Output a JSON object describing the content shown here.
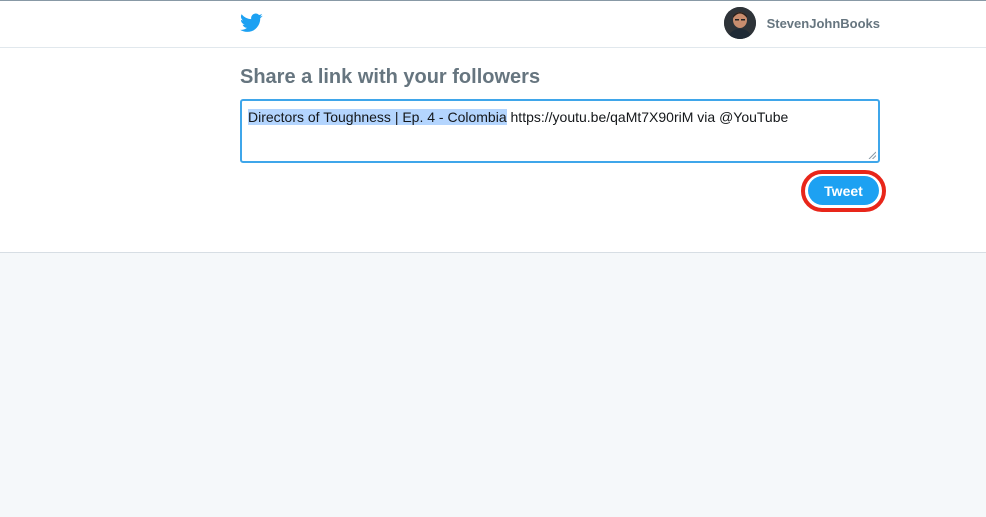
{
  "header": {
    "logo_icon": "twitter-bird-icon",
    "username": "StevenJohnBooks",
    "avatar_icon": "user-avatar"
  },
  "share": {
    "title": "Share a link with your followers",
    "tweet_selected_text": "Directors of Toughness | Ep. 4 - Colombia",
    "tweet_rest_text": " https://youtu.be/qaMt7X90riM via @YouTube",
    "tweet_button_label": "Tweet"
  },
  "colors": {
    "twitter_blue": "#1da1f2",
    "highlight_ring": "#e8261a",
    "selection": "#b4d5fe",
    "muted_text": "#66757f"
  }
}
